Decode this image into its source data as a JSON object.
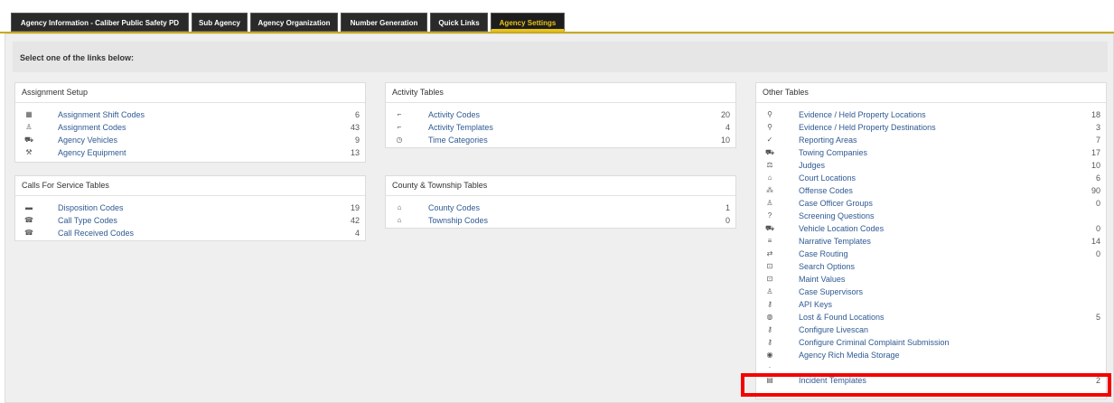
{
  "tabs": [
    {
      "label": "Agency Information - Caliber Public Safety PD",
      "active": false
    },
    {
      "label": "Sub Agency",
      "active": false
    },
    {
      "label": "Agency Organization",
      "active": false
    },
    {
      "label": "Number Generation",
      "active": false
    },
    {
      "label": "Quick Links",
      "active": false
    },
    {
      "label": "Agency Settings",
      "active": true
    }
  ],
  "instruction": "Select one of the links below:",
  "panels": {
    "assignment_setup": {
      "title": "Assignment Setup",
      "items": [
        {
          "label": "Assignment Shift Codes",
          "count": "6",
          "icon": "calendar-icon"
        },
        {
          "label": "Assignment Codes",
          "count": "43",
          "icon": "user-badge-icon"
        },
        {
          "label": "Agency Vehicles",
          "count": "9",
          "icon": "vehicle-icon"
        },
        {
          "label": "Agency Equipment",
          "count": "13",
          "icon": "equipment-icon"
        }
      ]
    },
    "calls_for_service": {
      "title": "Calls For Service Tables",
      "items": [
        {
          "label": "Disposition Codes",
          "count": "19",
          "icon": "car-icon"
        },
        {
          "label": "Call Type Codes",
          "count": "42",
          "icon": "phone-icon"
        },
        {
          "label": "Call Received Codes",
          "count": "4",
          "icon": "phone-icon"
        }
      ]
    },
    "activity_tables": {
      "title": "Activity Tables",
      "items": [
        {
          "label": "Activity Codes",
          "count": "20",
          "icon": "activity-icon"
        },
        {
          "label": "Activity Templates",
          "count": "4",
          "icon": "activity-icon"
        },
        {
          "label": "Time Categories",
          "count": "10",
          "icon": "clock-icon"
        }
      ]
    },
    "county_township": {
      "title": "County & Township Tables",
      "items": [
        {
          "label": "County Codes",
          "count": "1",
          "icon": "building-icon"
        },
        {
          "label": "Township Codes",
          "count": "0",
          "icon": "building-icon"
        }
      ]
    },
    "other_tables": {
      "title": "Other Tables",
      "items": [
        {
          "label": "Evidence / Held Property Locations",
          "count": "18",
          "icon": "search-icon"
        },
        {
          "label": "Evidence / Held Property Destinations",
          "count": "3",
          "icon": "search-icon"
        },
        {
          "label": "Reporting Areas",
          "count": "7",
          "icon": "check-icon"
        },
        {
          "label": "Towing Companies",
          "count": "17",
          "icon": "tow-truck-icon"
        },
        {
          "label": "Judges",
          "count": "10",
          "icon": "gavel-icon"
        },
        {
          "label": "Court Locations",
          "count": "6",
          "icon": "courthouse-icon"
        },
        {
          "label": "Offense Codes",
          "count": "90",
          "icon": "offense-icon"
        },
        {
          "label": "Case Officer Groups",
          "count": "0",
          "icon": "user-badge-icon"
        },
        {
          "label": "Screening Questions",
          "count": "",
          "icon": "question-icon"
        },
        {
          "label": "Vehicle Location Codes",
          "count": "0",
          "icon": "tow-truck-icon"
        },
        {
          "label": "Narrative Templates",
          "count": "14",
          "icon": "list-icon"
        },
        {
          "label": "Case Routing",
          "count": "0",
          "icon": "routing-icon"
        },
        {
          "label": "Search Options",
          "count": "",
          "icon": "search-options-icon"
        },
        {
          "label": "Maint Values",
          "count": "",
          "icon": "maint-icon"
        },
        {
          "label": "Case Supervisors",
          "count": "",
          "icon": "user-badge-icon"
        },
        {
          "label": "API Keys",
          "count": "",
          "icon": "key-icon"
        },
        {
          "label": "Lost & Found Locations",
          "count": "5",
          "icon": "lost-found-icon"
        },
        {
          "label": "Configure Livescan",
          "count": "",
          "icon": "key-icon"
        },
        {
          "label": "Configure Criminal Complaint Submission",
          "count": "",
          "icon": "key-icon"
        },
        {
          "label": "Agency Rich Media Storage",
          "count": "",
          "icon": "storage-icon"
        },
        {
          "label": "",
          "count": "",
          "icon": "partial-icon"
        },
        {
          "label": "Incident Templates",
          "count": "2",
          "icon": "clipboard-icon"
        }
      ]
    }
  },
  "colors": {
    "tab_bg": "#2a2a2a",
    "accent": "#e8c21b",
    "link": "#2f5a93",
    "highlight": "#f40000"
  }
}
